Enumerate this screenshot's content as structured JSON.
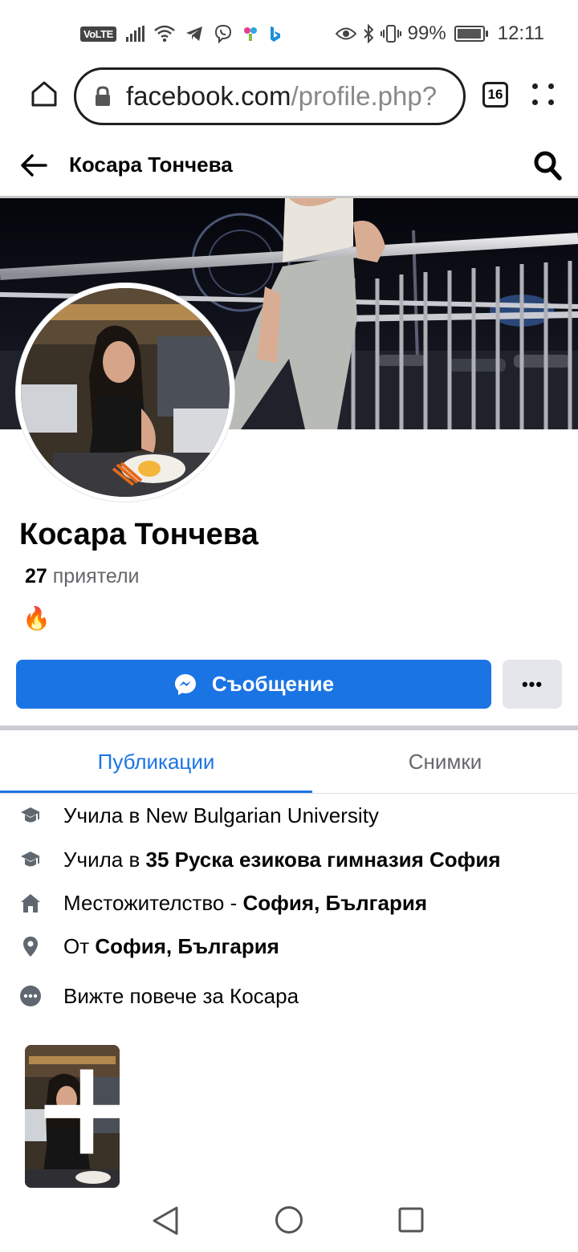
{
  "status_bar": {
    "volte": "VoLTE",
    "battery": "99%",
    "battery_level": 0.99,
    "time": "12:11"
  },
  "browser": {
    "url_host": "facebook.com",
    "url_path": "/profile.php?",
    "tab_count": "16"
  },
  "header": {
    "title": "Косара Тончева"
  },
  "profile": {
    "name": "Косара Тончева",
    "friends_count": "27",
    "friends_label": "приятели",
    "bio": "🔥"
  },
  "actions": {
    "message_label": "Съобщение",
    "more_label": "•••"
  },
  "tabs": [
    {
      "label": "Публикации",
      "active": true
    },
    {
      "label": "Снимки",
      "active": false
    }
  ],
  "intro": {
    "study1_prefix": "Учила в ",
    "study1_value": "New Bulgarian University",
    "study2_prefix": "Учила в ",
    "study2_value": "35 Руска езикова гимназия София",
    "lives_prefix": "Местожителство - ",
    "lives_value": "София, България",
    "from_prefix": "От ",
    "from_value": "София, България",
    "see_more": "Вижте повече за Косара"
  },
  "featured": {
    "count": "1"
  },
  "colors": {
    "accent": "#1b74e4",
    "secondary_text": "#65676b",
    "button_gray": "#e4e6eb"
  }
}
